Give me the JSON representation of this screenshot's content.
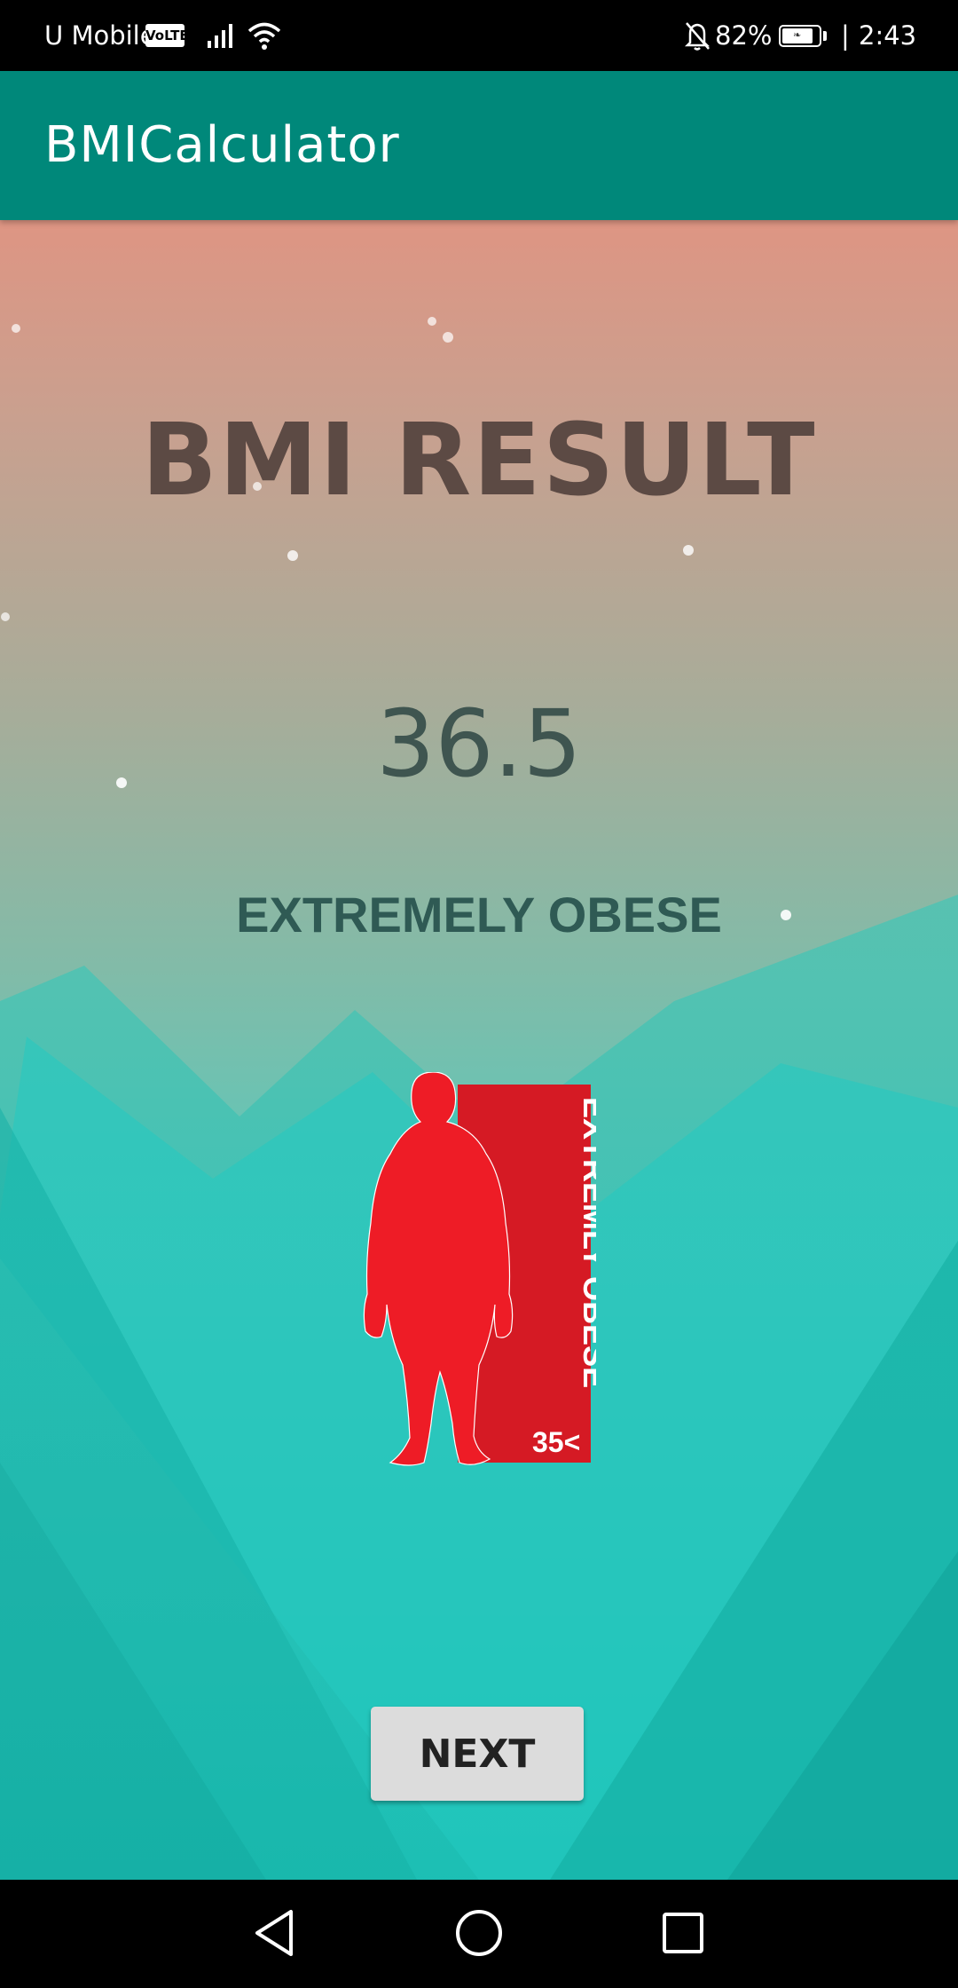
{
  "status_bar": {
    "carrier": "U Mobile",
    "volte": "VoLTE",
    "battery_percent": "82%",
    "separator": "|",
    "time": "2:43",
    "icons": [
      "signal-icon",
      "wifi-icon",
      "notifications-off-icon",
      "battery-icon"
    ]
  },
  "app_bar": {
    "title": "BMICalculator"
  },
  "result": {
    "title": "BMI RESULT",
    "bmi_value": "36.5",
    "category": "EXTREMELY OBESE"
  },
  "illustration": {
    "label": "EXTREMLY OBESE",
    "range": "35<",
    "figure_color": "#EE1C26",
    "panel_color": "#D51A24"
  },
  "actions": {
    "next_label": "NEXT"
  },
  "nav_bar": {
    "icons": [
      "back-icon",
      "home-icon",
      "recents-icon"
    ]
  },
  "colors": {
    "app_bar": "#00887A",
    "title_text": "#5C4A44",
    "value_text": "#3F5550",
    "category_text": "#2F5A54",
    "button": "#DCDCDC"
  }
}
